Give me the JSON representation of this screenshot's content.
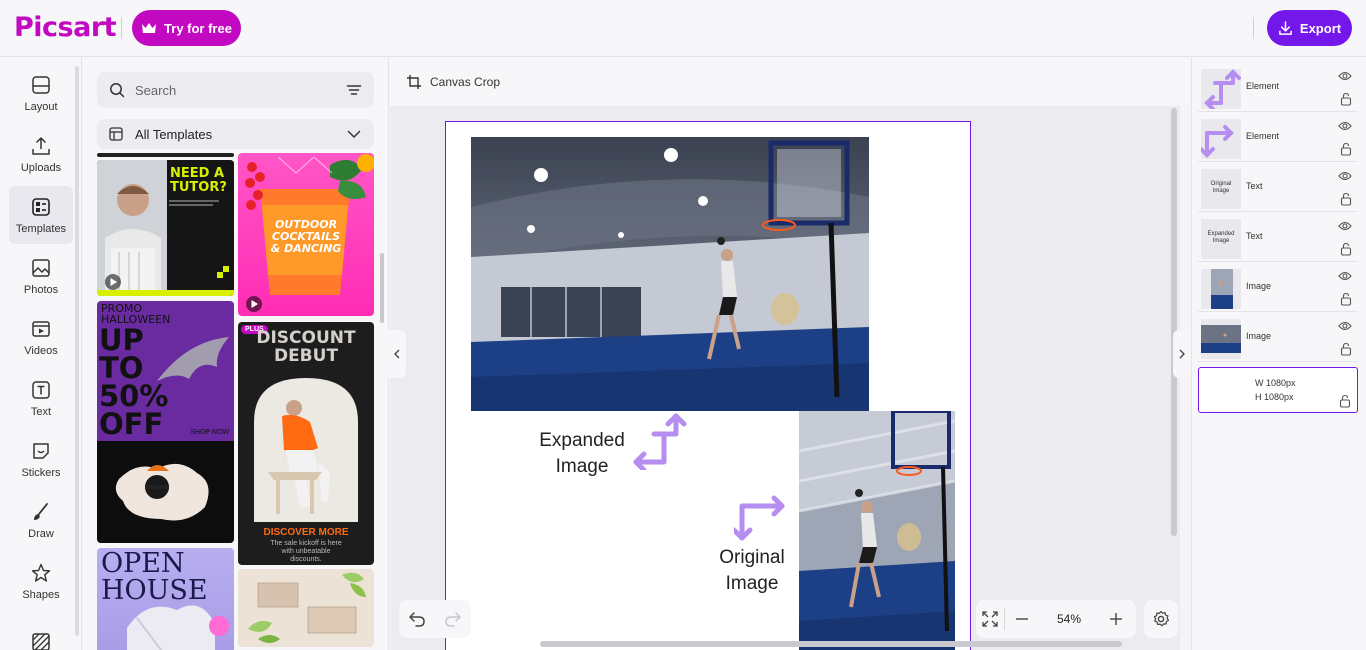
{
  "brand": {
    "logo_text": "Picsart",
    "accent": "#c209c1",
    "export_color": "#7417ea"
  },
  "topbar": {
    "try_label": "Try for free",
    "export_label": "Export"
  },
  "rail": {
    "items": [
      {
        "label": "Layout",
        "icon": "layout-icon"
      },
      {
        "label": "Uploads",
        "icon": "upload-icon"
      },
      {
        "label": "Templates",
        "icon": "templates-icon",
        "active": true
      },
      {
        "label": "Photos",
        "icon": "photos-icon"
      },
      {
        "label": "Videos",
        "icon": "videos-icon"
      },
      {
        "label": "Text",
        "icon": "text-icon"
      },
      {
        "label": "Stickers",
        "icon": "stickers-icon"
      },
      {
        "label": "Draw",
        "icon": "draw-icon"
      },
      {
        "label": "Shapes",
        "icon": "shapes-icon"
      }
    ]
  },
  "panel": {
    "search_placeholder": "Search",
    "select_value": "All Templates",
    "templates": {
      "tutor": {
        "line1": "NEED A",
        "line2": "TUTOR?"
      },
      "cocktails": {
        "line1": "OUTDOOR",
        "line2": "COCKTAILS",
        "line3": "& DANCING"
      },
      "halloween": {
        "line1": "PROMO",
        "line2": "HALLOWEEN",
        "line3": "UP",
        "line4": "TO",
        "line5": "50%",
        "line6": "OFF",
        "shop": "SHOP NOW"
      },
      "discount": {
        "badge": "PLUS",
        "line1": "DISCOUNT",
        "line2": "DEBUT",
        "cta": "DISCOVER MORE",
        "sub1": "The sale kickoff is here",
        "sub2": "with unbeatable",
        "sub3": "discounts."
      },
      "openhouse": {
        "line1": "OPEN",
        "line2": "HOUSE"
      }
    }
  },
  "canvas": {
    "tool_label": "Canvas Crop",
    "expanded_label_1": "Expanded",
    "expanded_label_2": "Image",
    "original_label_1": "Original",
    "original_label_2": "Image",
    "zoom": "54%"
  },
  "layers": {
    "items": [
      {
        "name": "Element"
      },
      {
        "name": "Element"
      },
      {
        "name": "Text",
        "thumb_text_1": "Original",
        "thumb_text_2": "Image"
      },
      {
        "name": "Text",
        "thumb_text_1": "Expanded",
        "thumb_text_2": "Image"
      },
      {
        "name": "Image"
      },
      {
        "name": "Image"
      }
    ],
    "background": {
      "w": "W 1080px",
      "h": "H 1080px"
    }
  }
}
